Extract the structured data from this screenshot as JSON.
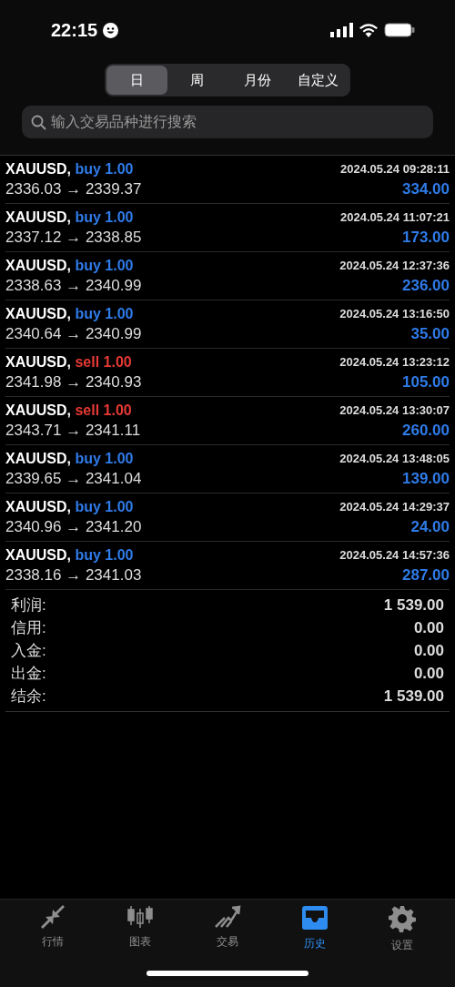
{
  "status_bar": {
    "time": "22:15"
  },
  "period_tabs": [
    {
      "label": "日",
      "selected": true
    },
    {
      "label": "周",
      "selected": false
    },
    {
      "label": "月份",
      "selected": false
    },
    {
      "label": "自定义",
      "selected": false
    }
  ],
  "search": {
    "placeholder": "输入交易品种进行搜索"
  },
  "deals": [
    {
      "symbol": "XAUUSD,",
      "kind": "buy",
      "side": "buy 1.00",
      "time": "2024.05.24 09:28:11",
      "prices": "2336.03 → 2339.37",
      "profit": "334.00"
    },
    {
      "symbol": "XAUUSD,",
      "kind": "buy",
      "side": "buy 1.00",
      "time": "2024.05.24 11:07:21",
      "prices": "2337.12 → 2338.85",
      "profit": "173.00"
    },
    {
      "symbol": "XAUUSD,",
      "kind": "buy",
      "side": "buy 1.00",
      "time": "2024.05.24 12:37:36",
      "prices": "2338.63 → 2340.99",
      "profit": "236.00"
    },
    {
      "symbol": "XAUUSD,",
      "kind": "buy",
      "side": "buy 1.00",
      "time": "2024.05.24 13:16:50",
      "prices": "2340.64 → 2340.99",
      "profit": "35.00"
    },
    {
      "symbol": "XAUUSD,",
      "kind": "sell",
      "side": "sell 1.00",
      "time": "2024.05.24 13:23:12",
      "prices": "2341.98 → 2340.93",
      "profit": "105.00"
    },
    {
      "symbol": "XAUUSD,",
      "kind": "sell",
      "side": "sell 1.00",
      "time": "2024.05.24 13:30:07",
      "prices": "2343.71 → 2341.11",
      "profit": "260.00"
    },
    {
      "symbol": "XAUUSD,",
      "kind": "buy",
      "side": "buy 1.00",
      "time": "2024.05.24 13:48:05",
      "prices": "2339.65 → 2341.04",
      "profit": "139.00"
    },
    {
      "symbol": "XAUUSD,",
      "kind": "buy",
      "side": "buy 1.00",
      "time": "2024.05.24 14:29:37",
      "prices": "2340.96 → 2341.20",
      "profit": "24.00"
    },
    {
      "symbol": "XAUUSD,",
      "kind": "buy",
      "side": "buy 1.00",
      "time": "2024.05.24 14:57:36",
      "prices": "2338.16 → 2341.03",
      "profit": "287.00"
    }
  ],
  "summary": [
    {
      "label": "利润:",
      "value": "1 539.00"
    },
    {
      "label": "信用:",
      "value": "0.00"
    },
    {
      "label": "入金:",
      "value": "0.00"
    },
    {
      "label": "出金:",
      "value": "0.00"
    },
    {
      "label": "结余:",
      "value": "1 539.00"
    }
  ],
  "tab_bar": [
    {
      "kind": "quotes",
      "label": "行情",
      "selected": false
    },
    {
      "kind": "chart",
      "label": "图表",
      "selected": false
    },
    {
      "kind": "trade",
      "label": "交易",
      "selected": false
    },
    {
      "kind": "history",
      "label": "历史",
      "selected": true
    },
    {
      "kind": "settings",
      "label": "设置",
      "selected": false
    }
  ]
}
